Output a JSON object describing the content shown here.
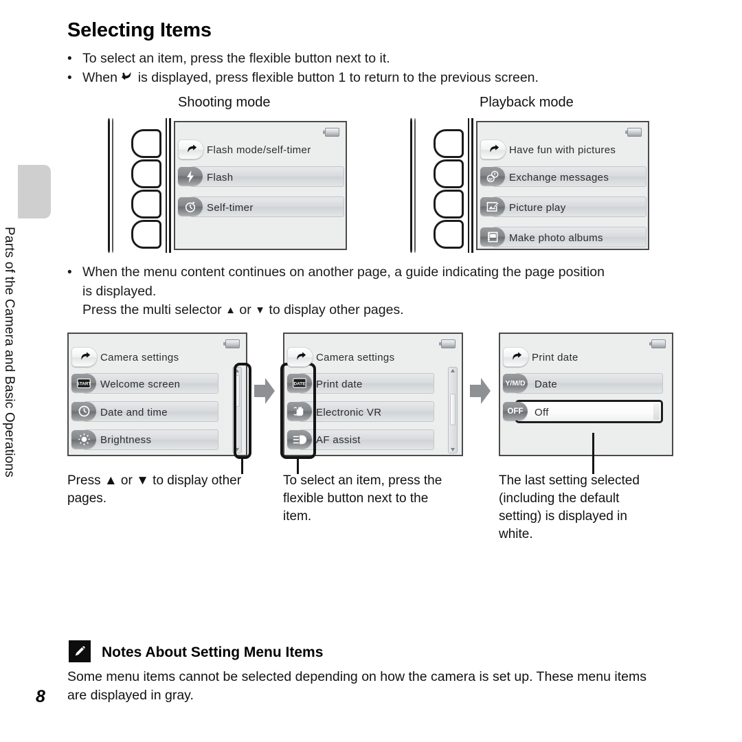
{
  "document": {
    "page_number": "8",
    "section_tab_label": "Parts of the Camera and Basic Operations",
    "heading": "Selecting Items"
  },
  "intro_bullets": [
    {
      "bullet": "•",
      "text_before": "To select an item, press the flexible button next to it.",
      "icon": "",
      "text_after": ""
    },
    {
      "bullet": "•",
      "text_before": "When ",
      "icon": "back-arrow-icon",
      "text_after": " is displayed, press flexible button 1 to return to the previous screen."
    }
  ],
  "mode_labels": {
    "shooting": "Shooting mode",
    "playback": "Playback mode"
  },
  "shooting_screen": {
    "title_row": {
      "icon": "back-arrow-icon",
      "label": "Flash mode/self-timer"
    },
    "items": [
      {
        "icon": "flash-icon",
        "label": "Flash"
      },
      {
        "icon": "self-timer-icon",
        "label": "Self-timer"
      }
    ],
    "status_icon": "battery-icon",
    "button_count": 4
  },
  "playback_screen": {
    "title_row": {
      "icon": "back-arrow-icon",
      "label": "Have fun with pictures"
    },
    "items": [
      {
        "icon": "exchange-messages-icon",
        "label": "Exchange messages"
      },
      {
        "icon": "picture-play-icon",
        "label": "Picture play"
      },
      {
        "icon": "photo-album-icon",
        "label": "Make photo albums"
      }
    ],
    "status_icon": "battery-icon",
    "button_count": 4
  },
  "middle_bullet": {
    "bullet": "•",
    "line1": "When the menu content continues on another page, a guide indicating the page position",
    "line2": "is displayed.",
    "line3_before": "Press the multi selector ",
    "line3_up": "▲",
    "line3_mid": " or ",
    "line3_down": "▼",
    "line3_after": " to display other pages."
  },
  "sequence": {
    "arrow_icon": "right-arrow-icon",
    "screens": [
      {
        "title_row": {
          "icon": "back-arrow-icon",
          "label": "Camera settings"
        },
        "items": [
          {
            "icon": "welcome-screen-icon",
            "icon_text": "START",
            "label": "Welcome screen"
          },
          {
            "icon": "clock-icon",
            "icon_text": "",
            "label": "Date and time"
          },
          {
            "icon": "brightness-icon",
            "icon_text": "",
            "label": "Brightness"
          }
        ],
        "status_icon": "battery-icon",
        "scrollbar": {
          "present": true,
          "thumb_position": "top"
        },
        "callout_target": "scrollbar",
        "caption_line1": "Press ▲ or ▼ to display other",
        "caption_line2": "pages."
      },
      {
        "title_row": {
          "icon": "back-arrow-icon",
          "label": "Camera settings"
        },
        "items": [
          {
            "icon": "print-date-icon",
            "icon_text": "DATE",
            "label": "Print date"
          },
          {
            "icon": "electronic-vr-icon",
            "icon_text": "",
            "label": "Electronic VR"
          },
          {
            "icon": "af-assist-icon",
            "icon_text": "",
            "label": "AF assist"
          }
        ],
        "status_icon": "battery-icon",
        "scrollbar": {
          "present": true,
          "thumb_position": "middle"
        },
        "callout_target": "item-icons",
        "caption_line1": "To select an item, press the",
        "caption_line2": "flexible button next to the",
        "caption_line3": "item."
      },
      {
        "title_row": {
          "icon": "back-arrow-icon",
          "label": "Print date"
        },
        "items": [
          {
            "icon": "ymd-icon",
            "icon_text": "Y/M/D",
            "label": "Date",
            "selected": false
          },
          {
            "icon": "off-icon",
            "icon_text": "OFF",
            "label": "Off",
            "selected": true
          }
        ],
        "status_icon": "battery-icon",
        "scrollbar": {
          "present": false,
          "thumb_position": ""
        },
        "callout_target": "off-row",
        "caption_line1": "The last setting selected",
        "caption_line2": "(including the default",
        "caption_line3": "setting) is displayed in",
        "caption_line4": "white."
      }
    ]
  },
  "notes": {
    "icon": "pencil-note-icon",
    "title": "Notes About Setting Menu Items",
    "line1": "Some menu items cannot be selected depending on how the camera is set up. These menu items",
    "line2": "are displayed in gray."
  },
  "colors": {
    "page_background": "#ffffff",
    "text": "#111111",
    "tab_gray": "#cfcfcf",
    "lcd_background": "#eceded",
    "lcd_border": "#4a4a4a",
    "row_gray": "#d8dbdd",
    "pill_gray": "#85888b",
    "callout_black": "#141414",
    "arrow_gray": "#8e9194"
  }
}
